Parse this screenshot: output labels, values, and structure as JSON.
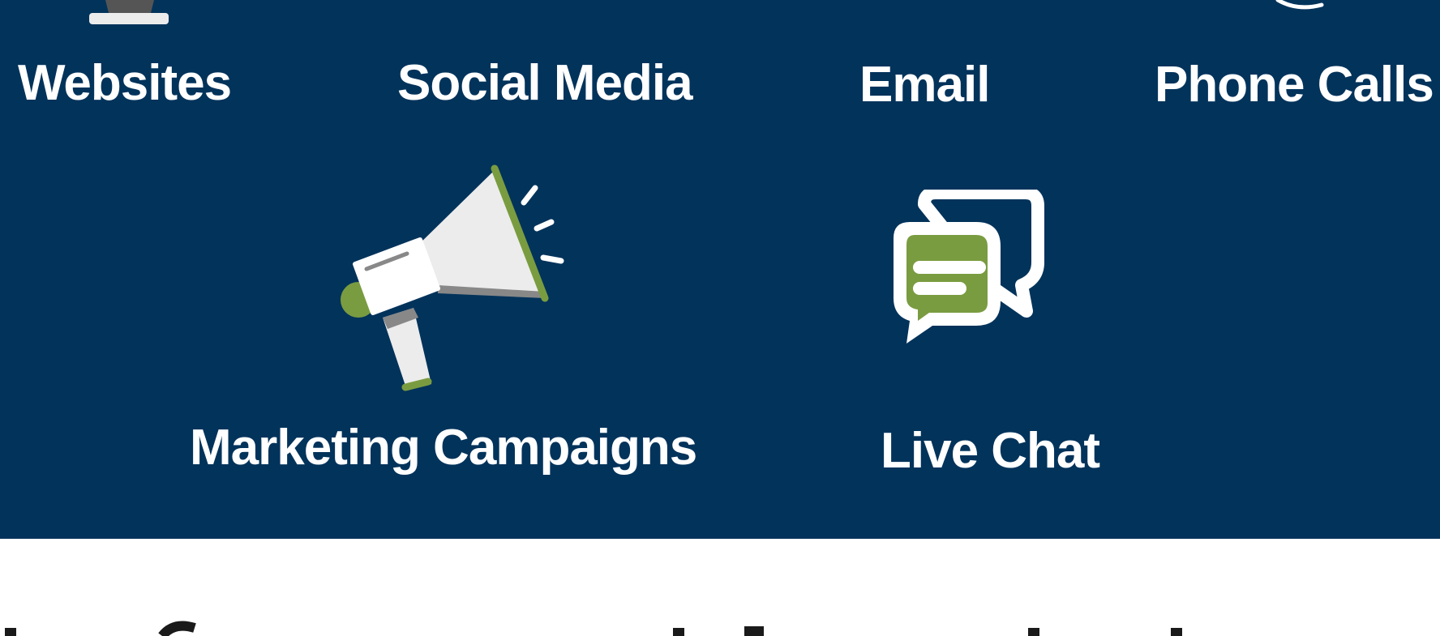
{
  "colors": {
    "panel_bg": "#02335b",
    "text": "#ffffff",
    "accent_green": "#7a9c40",
    "light_gray": "#ececec",
    "mid_gray": "#888888",
    "dark_gray": "#555555"
  },
  "channels": {
    "row1": [
      {
        "label": "Websites",
        "icon": "monitor-icon"
      },
      {
        "label": "Social Media",
        "icon": ""
      },
      {
        "label": "Email",
        "icon": ""
      },
      {
        "label": "Phone Calls",
        "icon": "phone-icon"
      }
    ],
    "row2": [
      {
        "label": "Marketing Campaigns",
        "icon": "megaphone-icon"
      },
      {
        "label": "Live Chat",
        "icon": "chat-bubbles-icon"
      }
    ]
  }
}
